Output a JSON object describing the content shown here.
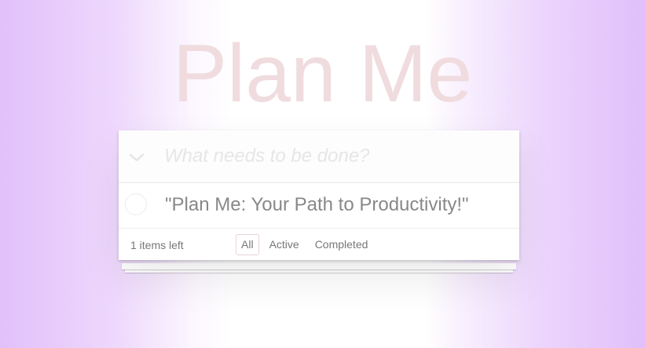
{
  "app": {
    "title": "Plan Me"
  },
  "new_todo": {
    "placeholder": "What needs to be done?",
    "value": ""
  },
  "todos": [
    {
      "label": "\"Plan Me: Your Path to Productivity!\"",
      "completed": false
    }
  ],
  "footer": {
    "items_left": "1 items left",
    "filters": [
      {
        "label": "All",
        "selected": true
      },
      {
        "label": "Active",
        "selected": false
      },
      {
        "label": "Completed",
        "selected": false
      }
    ]
  },
  "colors": {
    "title": "#f0dcdf",
    "background_edge": "#e2c0fb",
    "placeholder": "#e6e6e6",
    "item_text": "#888888"
  },
  "icons": {
    "toggle_all": "chevron-down-icon",
    "item_toggle": "circle-checkbox-icon"
  }
}
